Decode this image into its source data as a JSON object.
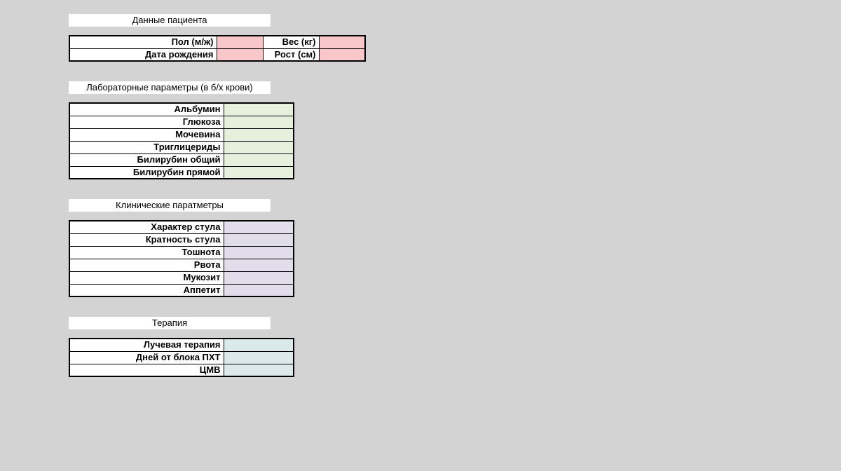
{
  "patient": {
    "title": "Данные пациента",
    "rows": [
      {
        "label1": "Пол (м/ж)",
        "value1": "",
        "label2": "Вес (кг)",
        "value2": ""
      },
      {
        "label1": "Дата рождения",
        "value1": "",
        "label2": "Рост (см)",
        "value2": ""
      }
    ]
  },
  "lab": {
    "title": "Лабораторные параметры (в б/х крови)",
    "rows": [
      {
        "label": "Альбумин",
        "value": ""
      },
      {
        "label": "Глюкоза",
        "value": ""
      },
      {
        "label": "Мочевина",
        "value": ""
      },
      {
        "label": "Триглицериды",
        "value": ""
      },
      {
        "label": "Билирубин общий",
        "value": ""
      },
      {
        "label": "Билирубин прямой",
        "value": ""
      }
    ]
  },
  "clinical": {
    "title": "Клинические паратметры",
    "rows": [
      {
        "label": "Характер стула",
        "value": ""
      },
      {
        "label": "Кратность стула",
        "value": ""
      },
      {
        "label": "Тошнота",
        "value": ""
      },
      {
        "label": "Рвота",
        "value": ""
      },
      {
        "label": "Мукозит",
        "value": ""
      },
      {
        "label": "Аппетит",
        "value": ""
      }
    ]
  },
  "therapy": {
    "title": "Терапия",
    "rows": [
      {
        "label": "Лучевая терапия",
        "value": ""
      },
      {
        "label": "Дней от блока ПХТ",
        "value": ""
      },
      {
        "label": "ЦМВ",
        "value": ""
      }
    ]
  }
}
